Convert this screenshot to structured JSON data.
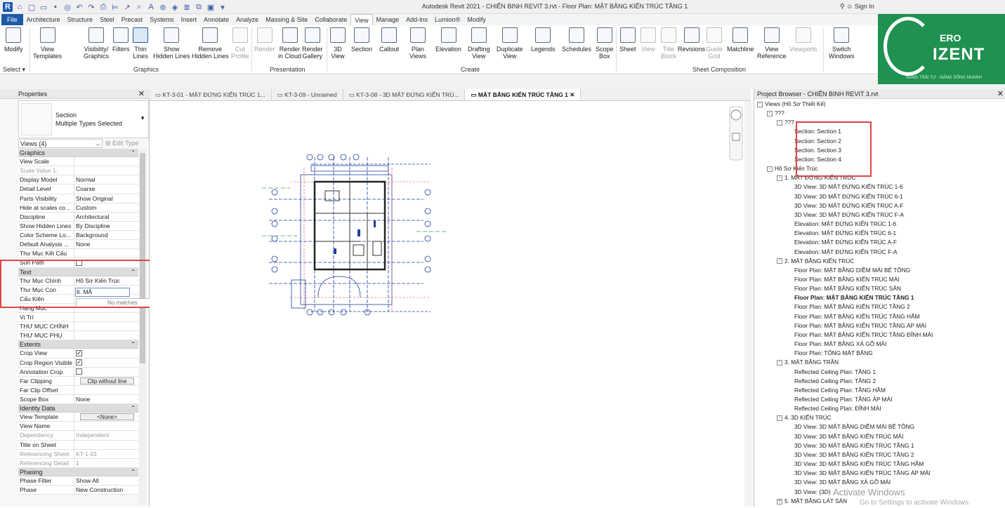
{
  "app_title": "Autodesk Revit 2021 - CHIẾN BINH REVIT 3.rvt - Floor Plan: MẶT BẰNG KIẾN TRÚC TẦNG 1",
  "signin": "Sign In",
  "ribbon_tabs": [
    "File",
    "Architecture",
    "Structure",
    "Steel",
    "Precast",
    "Systems",
    "Insert",
    "Annotate",
    "Analyze",
    "Massing & Site",
    "Collaborate",
    "View",
    "Manage",
    "Add-Ins",
    "Lumion®",
    "Modify"
  ],
  "active_tab": "View",
  "tools": {
    "modify": "Modify",
    "view_templates": [
      "View",
      "Templates"
    ],
    "visibility": [
      "Visibility/",
      "Graphics"
    ],
    "filters": "Filters",
    "thin_lines": [
      "Thin",
      "Lines"
    ],
    "show_hidden": [
      "Show",
      "Hidden Lines"
    ],
    "remove_hidden": [
      "Remove",
      "Hidden Lines"
    ],
    "cut_profile": [
      "Cut",
      "Profile"
    ],
    "render": "Render",
    "render_cloud": [
      "Render",
      "in Cloud"
    ],
    "render_gallery": [
      "Render",
      "Gallery"
    ],
    "view3d": [
      "3D",
      "View"
    ],
    "section": "Section",
    "callout": "Callout",
    "plan_views": [
      "Plan",
      "Views"
    ],
    "elevation": "Elevation",
    "drafting_view": [
      "Drafting",
      "View"
    ],
    "duplicate_view": [
      "Duplicate",
      "View"
    ],
    "legends": "Legends",
    "schedules": "Schedules",
    "scope_box": [
      "Scope",
      "Box"
    ],
    "sheet": "Sheet",
    "view": "View",
    "title_block": [
      "Title",
      "Block"
    ],
    "revisions": "Revisions",
    "guide_grid": [
      "Guide",
      "Grid"
    ],
    "matchline": "Matchline",
    "view_reference": [
      "View",
      "Reference"
    ],
    "viewports": "Viewports",
    "switch_windows": [
      "Switch",
      "Windows"
    ]
  },
  "group_labels": {
    "select": "Select ▾",
    "graphics": "Graphics",
    "presentation": "Presentation",
    "create": "Create",
    "sheet_composition": "Sheet Composition"
  },
  "logo": {
    "ero": "ERO",
    "izent": "IZENT",
    "tagline": "NÂNG TRẢI TỰ - NÂNG SỐNG NHANH"
  },
  "properties": {
    "title": "Properties",
    "type_line1": "Section",
    "type_line2": "Multiple Types Selected",
    "views_selector": "Views (4)",
    "edit_type": "Edit Type",
    "sections": [
      {
        "name": "Graphics",
        "rows": [
          {
            "k": "View Scale",
            "v": "",
            "gray": false
          },
          {
            "k": "Scale Value   1:",
            "v": "",
            "gray": true
          },
          {
            "k": "Display Model",
            "v": "Normal",
            "gray": false
          },
          {
            "k": "Detail Level",
            "v": "Coarse",
            "gray": false
          },
          {
            "k": "Parts Visibility",
            "v": "Show Original",
            "gray": false
          },
          {
            "k": "Hide at scales co...",
            "v": "Custom",
            "gray": false
          },
          {
            "k": "Discipline",
            "v": "Architectural",
            "gray": false
          },
          {
            "k": "Show Hidden Lines",
            "v": "By Discipline",
            "gray": false
          },
          {
            "k": "Color Scheme Lo...",
            "v": "Background",
            "gray": false
          },
          {
            "k": "Default Analysis ...",
            "v": "None",
            "gray": false
          },
          {
            "k": "Thư Mục Kết Cấu",
            "v": "",
            "gray": false
          },
          {
            "k": "Sun Path",
            "v": "",
            "cb": false,
            "gray": false
          }
        ]
      },
      {
        "name": "Text",
        "rows": [
          {
            "k": "Thư Mục Chính",
            "v": "Hồ Sơ Kiến Trúc",
            "gray": false
          },
          {
            "k": "Thư Mục Con",
            "v": "",
            "edit": "6. MẶ",
            "gray": false
          },
          {
            "k": "Cấu Kiện",
            "v": "",
            "gray": false
          },
          {
            "k": "Hạng Mục",
            "v": "",
            "gray": false
          },
          {
            "k": "Vị Trí",
            "v": "",
            "gray": false
          },
          {
            "k": "THƯ MỤC CHÍNH",
            "v": "",
            "gray": false
          },
          {
            "k": "THƯ MỤC PHỤ",
            "v": "",
            "gray": false
          }
        ]
      },
      {
        "name": "Extents",
        "rows": [
          {
            "k": "Crop View",
            "v": "",
            "cb": true,
            "gray": false
          },
          {
            "k": "Crop Region Visible",
            "v": "",
            "cb": true,
            "gray": false
          },
          {
            "k": "Annotation Crop",
            "v": "",
            "cb": false,
            "gray": false
          },
          {
            "k": "Far Clipping",
            "v": "",
            "btn": "Clip without line",
            "gray": false
          },
          {
            "k": "Far Clip Offset",
            "v": "",
            "gray": false
          },
          {
            "k": "Scope Box",
            "v": "None",
            "gray": false
          }
        ]
      },
      {
        "name": "Identity Data",
        "rows": [
          {
            "k": "View Template",
            "v": "",
            "btn": "<None>",
            "gray": false
          },
          {
            "k": "View Name",
            "v": "",
            "gray": false
          },
          {
            "k": "Dependency",
            "v": "Independent",
            "gray": true
          },
          {
            "k": "Title on Sheet",
            "v": "",
            "gray": false
          },
          {
            "k": "Referencing Sheet",
            "v": "KT-1-01",
            "gray": true
          },
          {
            "k": "Referencing Detail",
            "v": "1",
            "gray": true
          }
        ]
      },
      {
        "name": "Phasing",
        "rows": [
          {
            "k": "Phase Filter",
            "v": "Show All",
            "gray": false
          },
          {
            "k": "Phase",
            "v": "New Construction",
            "gray": false
          }
        ]
      }
    ],
    "no_matches": "No matches"
  },
  "view_tabs": [
    {
      "label": "KT-3-01 - MẶT ĐỨNG KIẾN TRÚC 1...",
      "active": false
    },
    {
      "label": "KT-3-09 - Unnamed",
      "active": false
    },
    {
      "label": "KT-3-08 - 3D MẶT ĐỨNG KIẾN TRÚ...",
      "active": false
    },
    {
      "label": "MẶT BẰNG KIẾN TRÚC TẦNG 1",
      "active": true
    }
  ],
  "project_browser": {
    "title": "Project Browser - CHIẾN BINH REVIT 3.rvt",
    "items": [
      {
        "t": "Views (Hồ Sơ Thiết Kế)",
        "d": 0,
        "tog": "-"
      },
      {
        "t": "???",
        "d": 1,
        "tog": "-"
      },
      {
        "t": "???",
        "d": 2,
        "tog": "-"
      },
      {
        "t": "Section: Section 1",
        "d": 3
      },
      {
        "t": "Section: Section 2",
        "d": 3
      },
      {
        "t": "Section: Section 3",
        "d": 3
      },
      {
        "t": "Section: Section 4",
        "d": 3
      },
      {
        "t": "Hồ Sơ Kiến Trúc",
        "d": 1,
        "tog": "-"
      },
      {
        "t": "1. MẶT ĐỨNG KIẾN TRÚC",
        "d": 2,
        "tog": "-"
      },
      {
        "t": "3D View: 3D MẶT ĐỨNG KIẾN TRÚC 1-6",
        "d": 3
      },
      {
        "t": "3D View: 3D MẶT ĐỨNG KIẾN TRÚC 6-1",
        "d": 3
      },
      {
        "t": "3D View: 3D MẶT ĐỨNG KIẾN TRÚC A-F",
        "d": 3
      },
      {
        "t": "3D View: 3D MẶT ĐỨNG KIẾN TRÚC F-A",
        "d": 3
      },
      {
        "t": "Elevation: MẶT ĐỨNG KIẾN TRÚC 1-6",
        "d": 3
      },
      {
        "t": "Elevation: MẶT ĐỨNG KIẾN TRÚC 6-1",
        "d": 3
      },
      {
        "t": "Elevation: MẶT ĐỨNG KIẾN TRÚC A-F",
        "d": 3
      },
      {
        "t": "Elevation: MẶT ĐỨNG KIẾN TRÚC F-A",
        "d": 3
      },
      {
        "t": "2. MẶT BẰNG KIẾN TRÚC",
        "d": 2,
        "tog": "-"
      },
      {
        "t": "Floor Plan: MẶT BẰNG DIỀM MÁI BÊ TÔNG",
        "d": 3
      },
      {
        "t": "Floor Plan: MẶT BẰNG KIẾN TRÚC MÁI",
        "d": 3
      },
      {
        "t": "Floor Plan: MẶT BẰNG KIẾN TRÚC SÂN",
        "d": 3
      },
      {
        "t": "Floor Plan: MẶT BẰNG KIẾN TRÚC TẦNG 1",
        "d": 3,
        "bold": true
      },
      {
        "t": "Floor Plan: MẶT BẰNG KIẾN TRÚC TẦNG 2",
        "d": 3
      },
      {
        "t": "Floor Plan: MẶT BẰNG KIẾN TRÚC TẦNG HẦM",
        "d": 3
      },
      {
        "t": "Floor Plan: MẶT BẰNG KIẾN TRÚC TẦNG ÁP MÁI",
        "d": 3
      },
      {
        "t": "Floor Plan: MẶT BẰNG KIẾN TRÚC TẦNG ĐỈNH MÁI",
        "d": 3
      },
      {
        "t": "Floor Plan: MẶT BẰNG XÀ GỒ MÁI",
        "d": 3
      },
      {
        "t": "Floor Plan: TỔNG MẶT BẰNG",
        "d": 3
      },
      {
        "t": "3. MẶT BẰNG TRẦN",
        "d": 2,
        "tog": "-"
      },
      {
        "t": "Reflected Ceiling Plan: TẦNG 1",
        "d": 3
      },
      {
        "t": "Reflected Ceiling Plan: TẦNG 2",
        "d": 3
      },
      {
        "t": "Reflected Ceiling Plan: TẦNG HẦM",
        "d": 3
      },
      {
        "t": "Reflected Ceiling Plan: TẦNG ÁP MÁI",
        "d": 3
      },
      {
        "t": "Reflected Ceiling Plan: ĐỈNH MÁI",
        "d": 3
      },
      {
        "t": "4. 3D KIẾN TRÚC",
        "d": 2,
        "tog": "-"
      },
      {
        "t": "3D View: 3D MẶT BẰNG DIỀM MÁI BÊ TÔNG",
        "d": 3
      },
      {
        "t": "3D View: 3D MẶT BẰNG KIẾN TRÚC MÁI",
        "d": 3
      },
      {
        "t": "3D View: 3D MẶT BẰNG KIẾN TRÚC TẦNG 1",
        "d": 3
      },
      {
        "t": "3D View: 3D MẶT BẰNG KIẾN TRÚC TẦNG 2",
        "d": 3
      },
      {
        "t": "3D View: 3D MẶT BẰNG KIẾN TRÚC TẦNG HẦM",
        "d": 3
      },
      {
        "t": "3D View: 3D MẶT BẰNG KIẾN TRÚC TẦNG ÁP MÁI",
        "d": 3
      },
      {
        "t": "3D View: 3D MẶT BẰNG XÀ GỒ MÁI",
        "d": 3
      },
      {
        "t": "3D View: {3D}",
        "d": 3
      },
      {
        "t": "5. MẶT BẰNG LÁT SÀN",
        "d": 2,
        "tog": "+"
      }
    ]
  },
  "watermark": {
    "line1": "Activate Windows",
    "line2": "Go to Settings to activate Windows."
  },
  "colors": {
    "accent": "#1e5aa8",
    "highlight_box": "#e04444",
    "logo_green": "#1f9150"
  }
}
